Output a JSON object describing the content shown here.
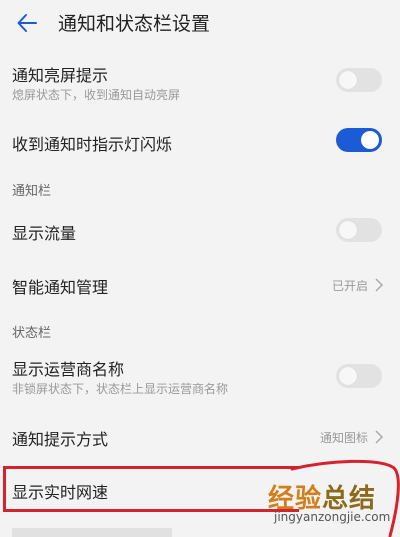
{
  "header": {
    "back_icon": "arrow-left-icon",
    "title": "通知和状态栏设置"
  },
  "items": {
    "wake_screen": {
      "title": "通知亮屏提示",
      "subtitle": "熄屏状态下，收到通知自动亮屏",
      "switch_on": false
    },
    "indicator_light": {
      "title": "收到通知时指示灯闪烁",
      "switch_on": true
    },
    "section_notification": {
      "label": "通知栏"
    },
    "show_traffic": {
      "title": "显示流量",
      "switch_on": false
    },
    "smart_notification": {
      "title": "智能通知管理",
      "value": "已开启"
    },
    "section_status": {
      "label": "状态栏"
    },
    "carrier_name": {
      "title": "显示运营商名称",
      "subtitle": "非锁屏状态下，状态栏上显示运营商名称",
      "switch_on": false
    },
    "notify_style": {
      "title": "通知提示方式",
      "value": "通知图标"
    },
    "realtime_speed": {
      "title": "显示实时网速"
    }
  },
  "colors": {
    "accent": "#1c5bd6",
    "highlight": "#d3232f",
    "background": "#f3f3f3"
  },
  "watermark": {
    "text_part1": "经验",
    "text_part2": "总结",
    "url": "jingyanzongjie.com"
  }
}
